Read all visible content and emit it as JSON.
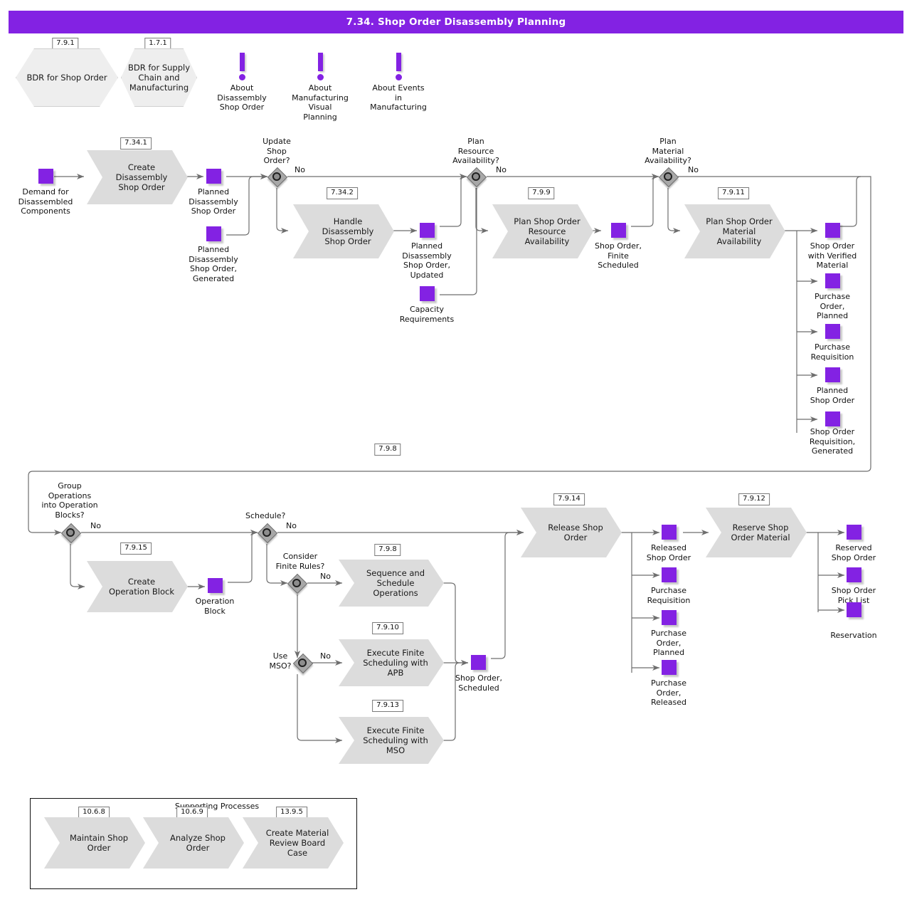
{
  "header": {
    "title": "7.34. Shop Order Disassembly Planning",
    "accent": "#8322e3"
  },
  "top_refs": [
    {
      "id": "7.9.1",
      "label": "BDR for Shop Order"
    },
    {
      "id": "1.7.1",
      "label": "BDR for Supply\nChain and\nManufacturing"
    }
  ],
  "notes": [
    {
      "label": "About\nDisassembly\nShop Order"
    },
    {
      "label": "About\nManufacturing\nVisual\nPlanning"
    },
    {
      "label": "About Events\nin\nManufacturing"
    }
  ],
  "processes": [
    {
      "id": "7.34.1",
      "label": "Create\nDisassembly\nShop Order"
    },
    {
      "id": "7.34.2",
      "label": "Handle\nDisassembly\nShop Order"
    },
    {
      "id": "7.9.9",
      "label": "Plan Shop Order\nResource\nAvailability"
    },
    {
      "id": "7.9.11",
      "label": "Plan Shop Order\nMaterial\nAvailability"
    },
    {
      "id": "7.9.15",
      "label": "Create\nOperation Block"
    },
    {
      "id": "7.9.8",
      "label": "Sequence and\nSchedule\nOperations"
    },
    {
      "id": "7.9.10",
      "label": "Execute Finite\nScheduling with\nAPB"
    },
    {
      "id": "7.9.13",
      "label": "Execute Finite\nScheduling with\nMSO"
    },
    {
      "id": "7.9.14",
      "label": "Release Shop\nOrder"
    },
    {
      "id": "7.9.12",
      "label": "Reserve Shop\nOrder Material"
    }
  ],
  "gateways": [
    {
      "label": "Update\nShop\nOrder?",
      "branch": "No"
    },
    {
      "label": "Plan\nResource\nAvailability?",
      "branch": "No"
    },
    {
      "label": "Plan\nMaterial\nAvailability?",
      "branch": "No"
    },
    {
      "label": "Group\nOperations\ninto Operation\nBlocks?",
      "branch": "No"
    },
    {
      "label": "Schedule?",
      "branch": "No"
    },
    {
      "label": "Consider\nFinite Rules?",
      "branch": "No"
    },
    {
      "label": "Use\nMSO?",
      "branch": "No"
    }
  ],
  "objects": [
    {
      "key": "demand",
      "label": "Demand for\nDisassembled\nComponents"
    },
    {
      "key": "planned_dso",
      "label": "Planned\nDisassembly\nShop Order"
    },
    {
      "key": "planned_dso_gen",
      "label": "Planned\nDisassembly\nShop Order,\nGenerated"
    },
    {
      "key": "planned_dso_upd",
      "label": "Planned\nDisassembly\nShop Order,\nUpdated"
    },
    {
      "key": "capacity_req",
      "label": "Capacity\nRequirements"
    },
    {
      "key": "so_finite",
      "label": "Shop Order,\nFinite\nScheduled"
    },
    {
      "key": "so_verified",
      "label": "Shop Order\nwith Verified\nMaterial"
    },
    {
      "key": "po_planned_a",
      "label": "Purchase\nOrder,\nPlanned"
    },
    {
      "key": "pr_a",
      "label": "Purchase\nRequisition"
    },
    {
      "key": "planned_so",
      "label": "Planned\nShop Order"
    },
    {
      "key": "so_req_gen",
      "label": "Shop Order\nRequisition,\nGenerated"
    },
    {
      "key": "operation_block",
      "label": "Operation\nBlock"
    },
    {
      "key": "so_scheduled",
      "label": "Shop Order,\nScheduled"
    },
    {
      "key": "released_so",
      "label": "Released\nShop Order"
    },
    {
      "key": "pr_b",
      "label": "Purchase\nRequisition"
    },
    {
      "key": "po_planned_b",
      "label": "Purchase\nOrder,\nPlanned"
    },
    {
      "key": "po_released",
      "label": "Purchase\nOrder,\nReleased"
    },
    {
      "key": "reserved_so",
      "label": "Reserved\nShop Order"
    },
    {
      "key": "so_pick_list",
      "label": "Shop Order\nPick List"
    },
    {
      "key": "reservation",
      "label": "Reservation"
    }
  ],
  "supporting": {
    "title": "Supporting Processes",
    "items": [
      {
        "id": "10.6.8",
        "label": "Maintain Shop\nOrder"
      },
      {
        "id": "10.6.9",
        "label": "Analyze Shop\nOrder"
      },
      {
        "id": "13.9.5",
        "label": "Create Material\nReview Board\nCase"
      }
    ]
  }
}
